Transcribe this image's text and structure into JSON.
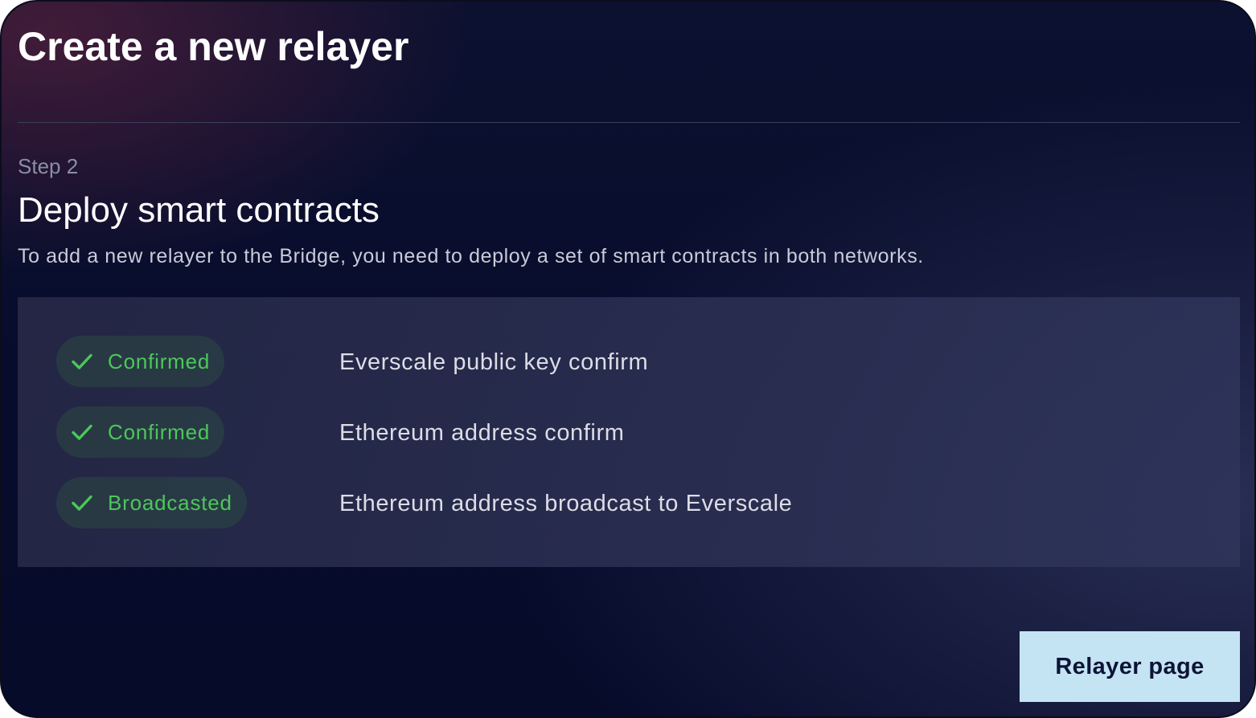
{
  "modal": {
    "title": "Create a new relayer"
  },
  "step": {
    "label": "Step 2",
    "title": "Deploy smart contracts",
    "description": "To add a new relayer to the Bridge, you need to deploy a set of smart contracts in both networks."
  },
  "tasks": [
    {
      "status": "Confirmed",
      "icon": "check-icon",
      "label": "Everscale public key confirm"
    },
    {
      "status": "Confirmed",
      "icon": "check-icon",
      "label": "Ethereum address confirm"
    },
    {
      "status": "Broadcasted",
      "icon": "check-icon",
      "label": "Ethereum address broadcast to Everscale"
    }
  ],
  "actions": {
    "relayer_page_label": "Relayer page"
  },
  "colors": {
    "status_success": "#4cc75a",
    "button_bg": "#c5e4f3",
    "button_text": "#0c1437",
    "background": "#070c2c"
  }
}
